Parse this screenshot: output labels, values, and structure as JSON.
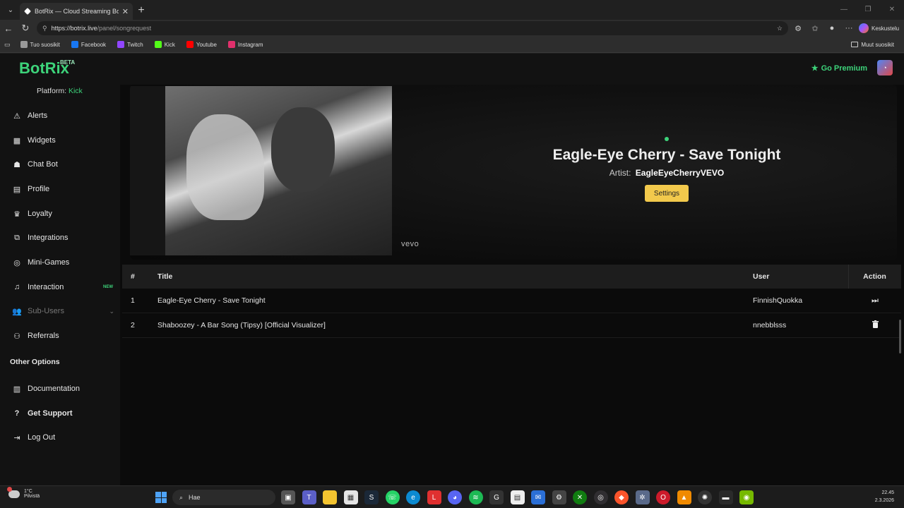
{
  "browser": {
    "tab_title": "BotRix — Cloud Streaming Bot",
    "url_host": "https://botrix.live",
    "url_path": "/panel/songrequest",
    "copilot_label": "Keskustelu",
    "bookmarks": [
      {
        "label": "Tuo suosikit",
        "color": "#999999",
        "icon": "import-icon"
      },
      {
        "label": "Facebook",
        "color": "#1877f2",
        "icon": "facebook-icon"
      },
      {
        "label": "Twitch",
        "color": "#9146ff",
        "icon": "twitch-icon"
      },
      {
        "label": "Kick",
        "color": "#53fc18",
        "icon": "kick-icon"
      },
      {
        "label": "Youtube",
        "color": "#ff0000",
        "icon": "youtube-icon"
      },
      {
        "label": "Instagram",
        "color": "#e1306c",
        "icon": "instagram-icon"
      }
    ],
    "other_bookmarks": "Muut suosikit"
  },
  "app": {
    "brand": "BotRix",
    "brand_badge": "BETA",
    "premium_label": "Go Premium",
    "accent": "#3dd37a"
  },
  "sidebar": {
    "platform_label": "Platform:",
    "platform_value": "Kick",
    "items": [
      {
        "label": "Alerts",
        "icon": "alert-icon"
      },
      {
        "label": "Widgets",
        "icon": "widgets-icon"
      },
      {
        "label": "Chat Bot",
        "icon": "robot-icon"
      },
      {
        "label": "Profile",
        "icon": "profile-icon"
      },
      {
        "label": "Loyalty",
        "icon": "trophy-icon"
      },
      {
        "label": "Integrations",
        "icon": "integrations-icon"
      },
      {
        "label": "Mini-Games",
        "icon": "gamepad-icon"
      },
      {
        "label": "Interaction",
        "icon": "music-icon",
        "badge": "NEW"
      },
      {
        "label": "Sub-Users",
        "icon": "users-icon"
      },
      {
        "label": "Referrals",
        "icon": "referrals-icon"
      }
    ],
    "other_title": "Other Options",
    "other_items": [
      {
        "label": "Documentation",
        "icon": "docs-icon"
      },
      {
        "label": "Get Support",
        "icon": "help-icon"
      },
      {
        "label": "Log Out",
        "icon": "logout-icon"
      }
    ]
  },
  "player": {
    "watermark": "vevo",
    "song_title": "Eagle-Eye Cherry - Save Tonight",
    "artist_label": "Artist:",
    "artist_value": "EagleEyeCherryVEVO",
    "settings_label": "Settings"
  },
  "queue": {
    "columns": [
      "#",
      "Title",
      "User",
      "Action"
    ],
    "rows": [
      {
        "num": "1",
        "title": "Eagle-Eye Cherry - Save Tonight",
        "user": "FinnishQuokka",
        "action": "skip-icon"
      },
      {
        "num": "2",
        "title": "Shaboozey - A Bar Song (Tipsy) [Official Visualizer]",
        "user": "nnebblsss",
        "action": "trash-icon"
      }
    ]
  },
  "taskbar": {
    "temp": "1°C",
    "weather": "Pilvistä",
    "search_placeholder": "Hae",
    "time": "22.45",
    "date": "2.3.2026"
  }
}
